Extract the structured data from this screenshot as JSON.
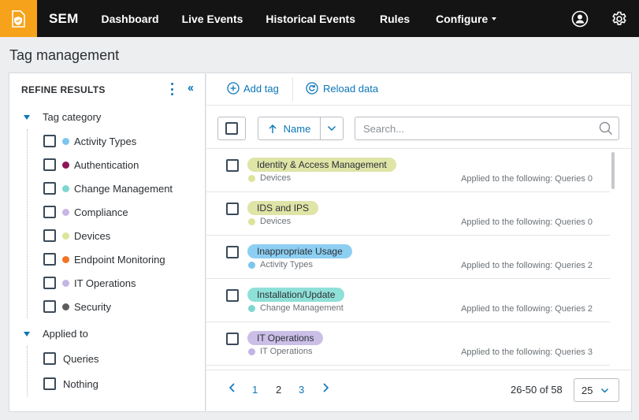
{
  "nav": {
    "brand": "SEM",
    "items": [
      "Dashboard",
      "Live Events",
      "Historical Events",
      "Rules"
    ],
    "configure": "Configure",
    "icons": [
      "app-shield-icon",
      "user-icon",
      "gear-icon"
    ]
  },
  "page": {
    "title": "Tag management"
  },
  "sidebar": {
    "header": "REFINE RESULTS",
    "groups": [
      {
        "label": "Tag category",
        "items": [
          {
            "label": "Activity Types",
            "color": "#7cc6ee"
          },
          {
            "label": "Authentication",
            "color": "#8c1457"
          },
          {
            "label": "Change Management",
            "color": "#7dd7cf"
          },
          {
            "label": "Compliance",
            "color": "#c9b6e6"
          },
          {
            "label": "Devices",
            "color": "#dde49a"
          },
          {
            "label": "Endpoint Monitoring",
            "color": "#f07522"
          },
          {
            "label": "IT Operations",
            "color": "#c3b5e3"
          },
          {
            "label": "Security",
            "color": "#5d5d5d"
          }
        ]
      },
      {
        "label": "Applied to",
        "items": [
          {
            "label": "Queries"
          },
          {
            "label": "Nothing"
          }
        ]
      }
    ]
  },
  "toolbar": {
    "add_tag": "Add tag",
    "reload": "Reload data"
  },
  "list_controls": {
    "sort_label": "Name",
    "search_placeholder": "Search..."
  },
  "tags": [
    {
      "name": "Identity & Access Management",
      "pill_color": "#dfe4a7",
      "category": "Devices",
      "category_color": "#dde49a",
      "applied": "Applied to the following: Queries 0"
    },
    {
      "name": "IDS and IPS",
      "pill_color": "#dfe4a7",
      "category": "Devices",
      "category_color": "#dde49a",
      "applied": "Applied to the following: Queries 0"
    },
    {
      "name": "Inappropriate Usage",
      "pill_color": "#8dcff3",
      "category": "Activity Types",
      "category_color": "#7cc6ee",
      "applied": "Applied to the following: Queries 2"
    },
    {
      "name": "Installation/Update",
      "pill_color": "#8fe0d8",
      "category": "Change Management",
      "category_color": "#7dd7cf",
      "applied": "Applied to the following: Queries 2"
    },
    {
      "name": "IT Operations",
      "pill_color": "#cbbfe8",
      "category": "IT Operations",
      "category_color": "#c3b5e3",
      "applied": "Applied to the following: Queries 3"
    }
  ],
  "pagination": {
    "pages": [
      "1",
      "2",
      "3"
    ],
    "current": "2",
    "range": "26-50 of 58",
    "per_page": "25"
  }
}
